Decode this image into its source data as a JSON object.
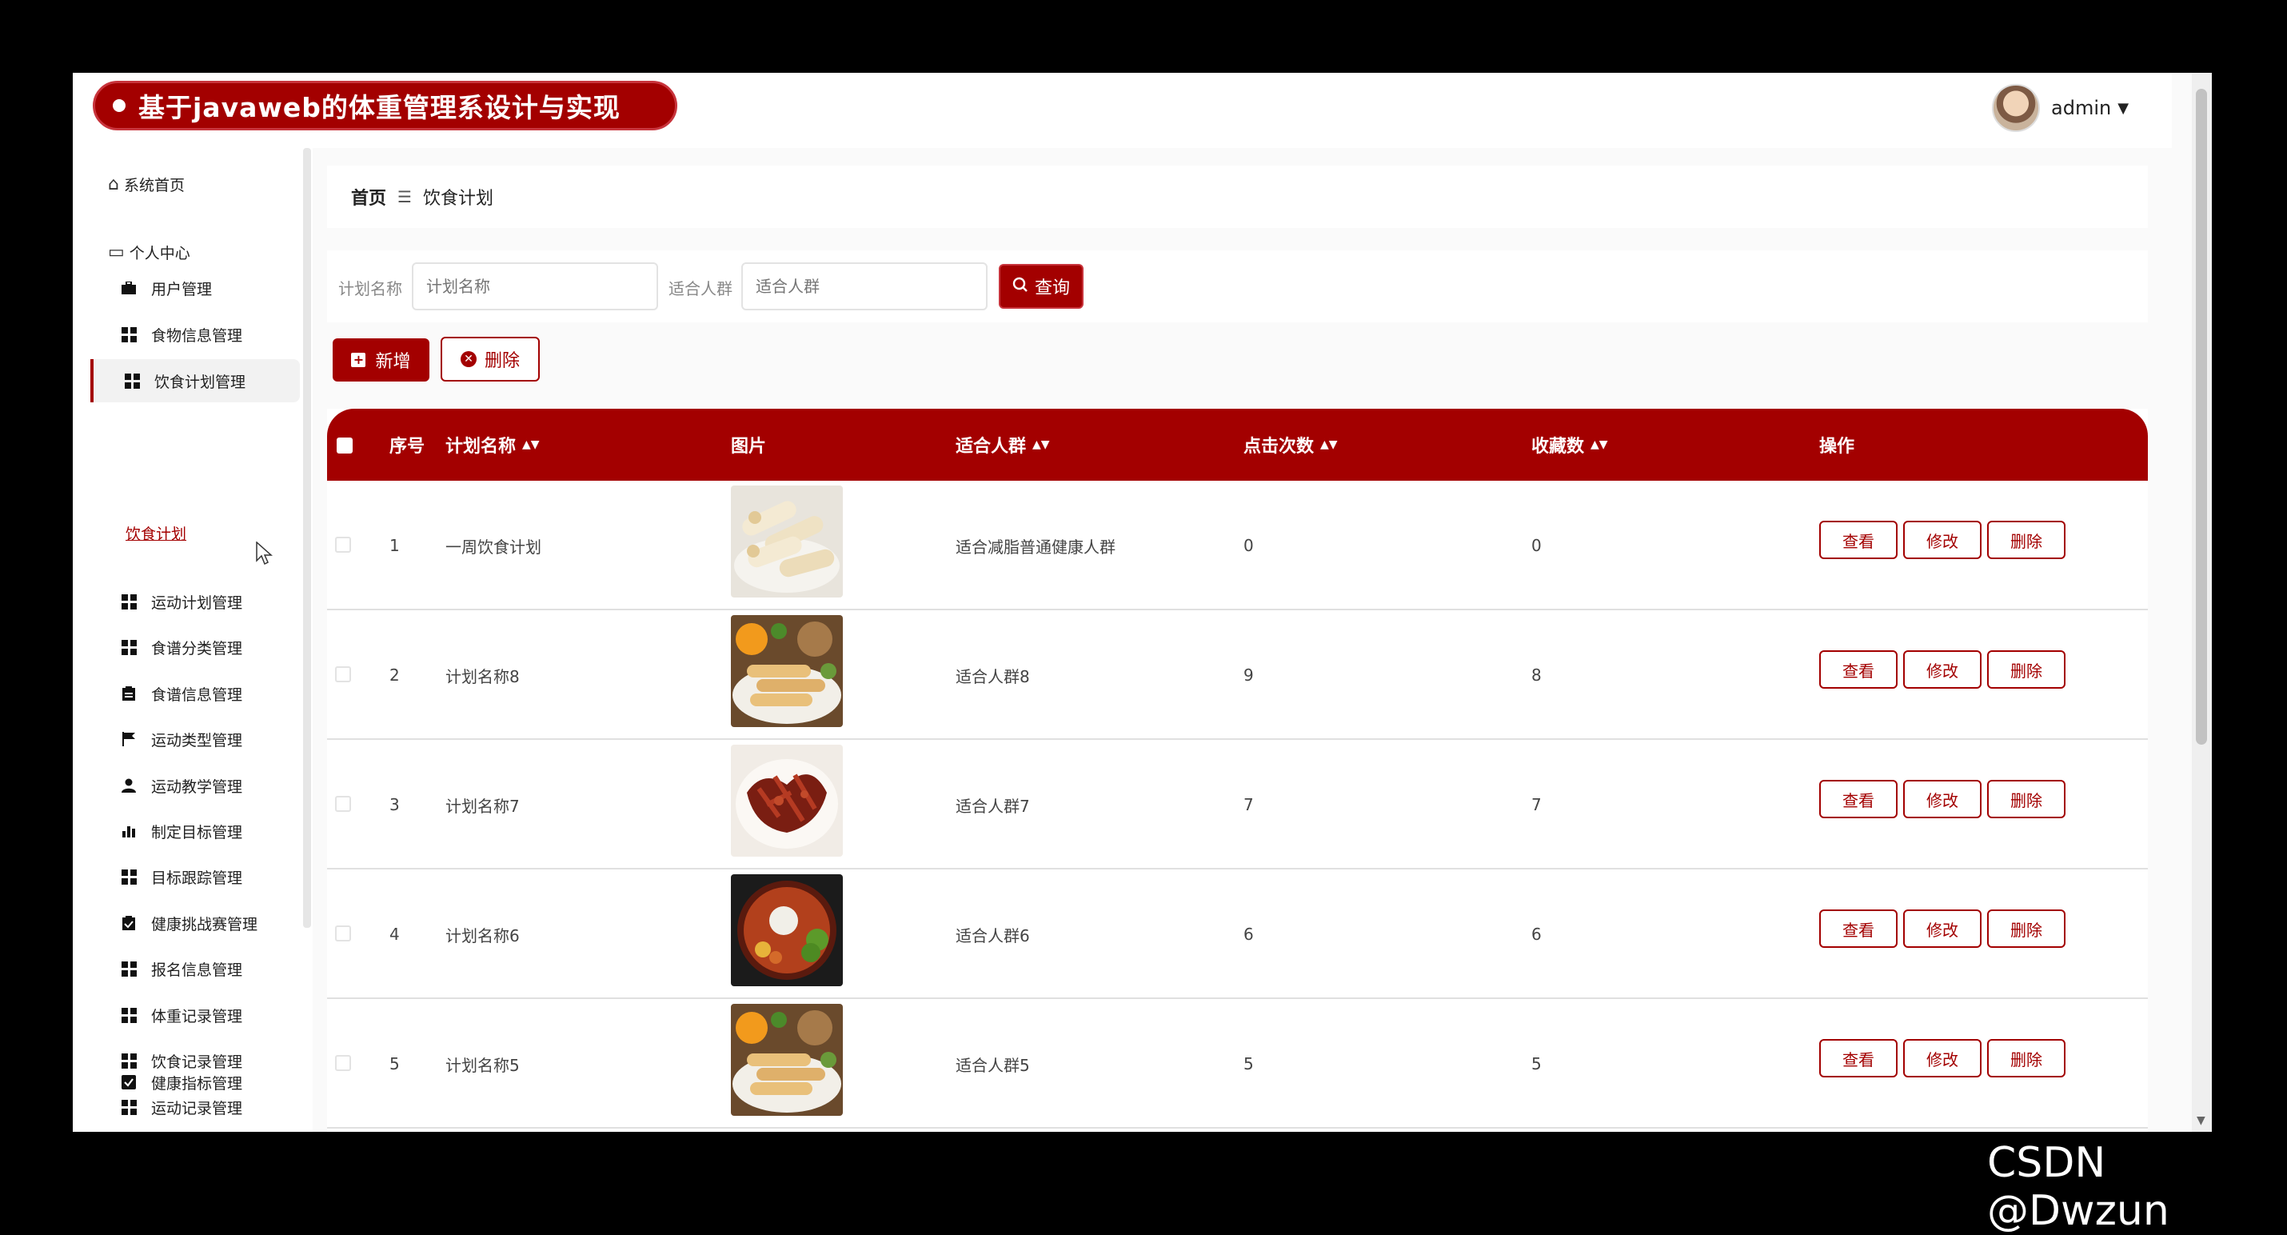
{
  "header": {
    "title": "基于javaweb的体重管理系设计与实现",
    "username": "admin"
  },
  "sidebar": {
    "home": "系统首页",
    "personal_center": "个人中心",
    "items": [
      {
        "label": "用户管理",
        "icon": "briefcase-icon"
      },
      {
        "label": "食物信息管理",
        "icon": "grid-icon"
      },
      {
        "label": "饮食计划管理",
        "icon": "grid-icon",
        "active": true
      },
      {
        "label": "运动计划管理",
        "icon": "grid-icon"
      },
      {
        "label": "食谱分类管理",
        "icon": "grid-icon"
      },
      {
        "label": "食谱信息管理",
        "icon": "clipboard-icon"
      },
      {
        "label": "运动类型管理",
        "icon": "flag-icon"
      },
      {
        "label": "运动教学管理",
        "icon": "person-icon"
      },
      {
        "label": "制定目标管理",
        "icon": "bar-chart-icon"
      },
      {
        "label": "目标跟踪管理",
        "icon": "grid-icon"
      },
      {
        "label": "健康挑战赛管理",
        "icon": "clipboard-check-icon"
      },
      {
        "label": "报名信息管理",
        "icon": "grid-icon"
      },
      {
        "label": "体重记录管理",
        "icon": "grid-icon"
      },
      {
        "label": "饮食记录管理",
        "icon": "grid-icon"
      },
      {
        "label": "运动记录管理",
        "icon": "grid-icon"
      },
      {
        "label": "健康指标管理",
        "icon": "checkbox-icon"
      }
    ],
    "sub_item": "饮食计划"
  },
  "breadcrumb": {
    "home": "首页",
    "separator": "☰",
    "current": "饮食计划"
  },
  "search": {
    "plan_name_label": "计划名称",
    "plan_name_placeholder": "计划名称",
    "crowd_label": "适合人群",
    "crowd_placeholder": "适合人群",
    "query_label": "查询"
  },
  "actions": {
    "add_label": "新增",
    "delete_label": "删除"
  },
  "table": {
    "columns": {
      "index": "序号",
      "name": "计划名称",
      "image": "图片",
      "crowd": "适合人群",
      "clicks": "点击次数",
      "favorites": "收藏数",
      "ops": "操作"
    },
    "row_buttons": {
      "view": "查看",
      "edit": "修改",
      "delete": "删除"
    },
    "rows": [
      {
        "index": "1",
        "name": "一周饮食计划",
        "crowd": "适合减脂普通健康人群",
        "clicks": "0",
        "favorites": "0"
      },
      {
        "index": "2",
        "name": "计划名称8",
        "crowd": "适合人群8",
        "clicks": "9",
        "favorites": "8"
      },
      {
        "index": "3",
        "name": "计划名称7",
        "crowd": "适合人群7",
        "clicks": "7",
        "favorites": "7"
      },
      {
        "index": "4",
        "name": "计划名称6",
        "crowd": "适合人群6",
        "clicks": "6",
        "favorites": "6"
      },
      {
        "index": "5",
        "name": "计划名称5",
        "crowd": "适合人群5",
        "clicks": "5",
        "favorites": "5"
      }
    ]
  },
  "colors": {
    "accent": "#a30000",
    "accent_border": "#c8343c"
  },
  "watermark": "CSDN @Dwzun"
}
